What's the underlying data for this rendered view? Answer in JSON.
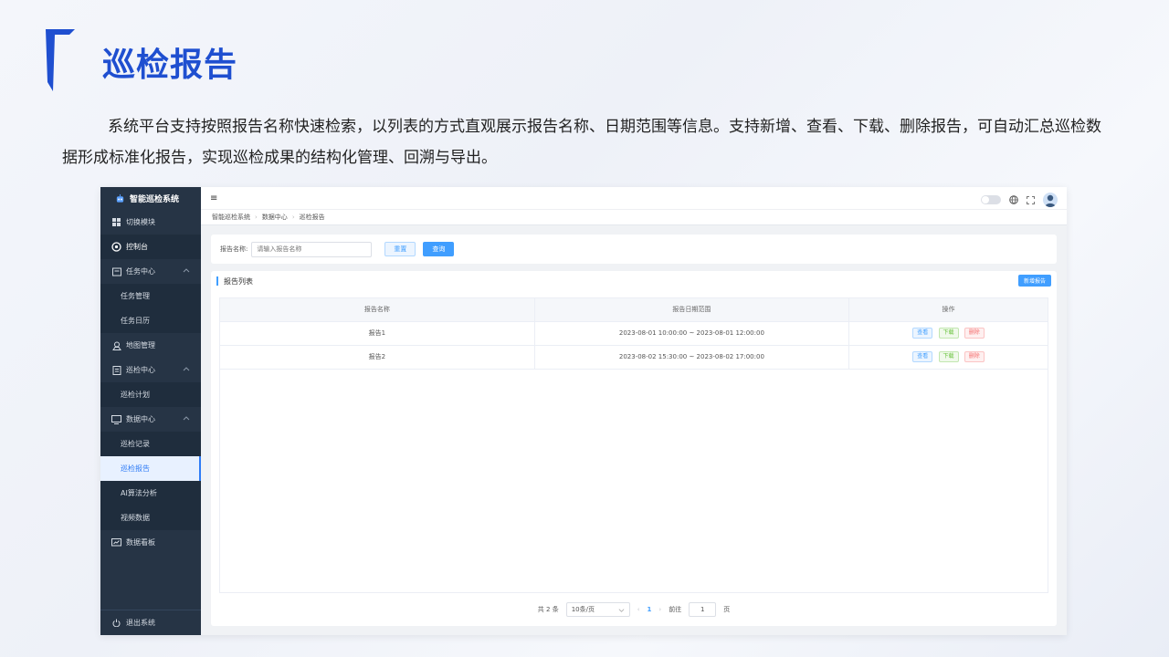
{
  "slide": {
    "title": "巡检报告",
    "description": "系统平台支持按照报告名称快速检索，以列表的方式直观展示报告名称、日期范围等信息。支持新增、查看、下载、删除报告，可自动汇总巡检数据形成标准化报告，实现巡检成果的结构化管理、回溯与导出。"
  },
  "app": {
    "brand": "智能巡检系统",
    "sidebar": {
      "items": [
        {
          "label": "切换模块",
          "icon": "grid-icon"
        },
        {
          "label": "控制台",
          "icon": "dashboard-icon"
        },
        {
          "label": "任务中心",
          "icon": "task-icon"
        },
        {
          "label": "任务管理"
        },
        {
          "label": "任务日历"
        },
        {
          "label": "地图管理",
          "icon": "map-icon"
        },
        {
          "label": "巡检中心",
          "icon": "inspection-icon"
        },
        {
          "label": "巡检计划"
        },
        {
          "label": "数据中心",
          "icon": "monitor-icon"
        },
        {
          "label": "巡检记录"
        },
        {
          "label": "巡检报告"
        },
        {
          "label": "AI算法分析"
        },
        {
          "label": "视频数据"
        },
        {
          "label": "数据看板",
          "icon": "board-icon"
        }
      ],
      "logout": "退出系统"
    },
    "breadcrumb": [
      "智能巡检系统",
      "数据中心",
      "巡检报告"
    ],
    "search": {
      "label": "报告名称:",
      "placeholder": "请输入报告名称",
      "reset": "重置",
      "query": "查询"
    },
    "list": {
      "title": "报告列表",
      "add_button": "新增报告",
      "columns": [
        "报告名称",
        "报告日期范围",
        "操作"
      ],
      "rows": [
        {
          "name": "报告1",
          "range": "2023-08-01 10:00:00 ~ 2023-08-01 12:00:00"
        },
        {
          "name": "报告2",
          "range": "2023-08-02 15:30:00 ~ 2023-08-02 17:00:00"
        }
      ],
      "actions": {
        "view": "查看",
        "download": "下载",
        "delete": "删除"
      }
    },
    "pager": {
      "total": "共 2 条",
      "page_size": "10条/页",
      "current": "1",
      "goto_label": "前往",
      "goto_value": "1",
      "page_suffix": "页"
    }
  },
  "colors": {
    "title": "#1f4fd0",
    "sidebar": "#263445",
    "accent": "#409eff"
  }
}
